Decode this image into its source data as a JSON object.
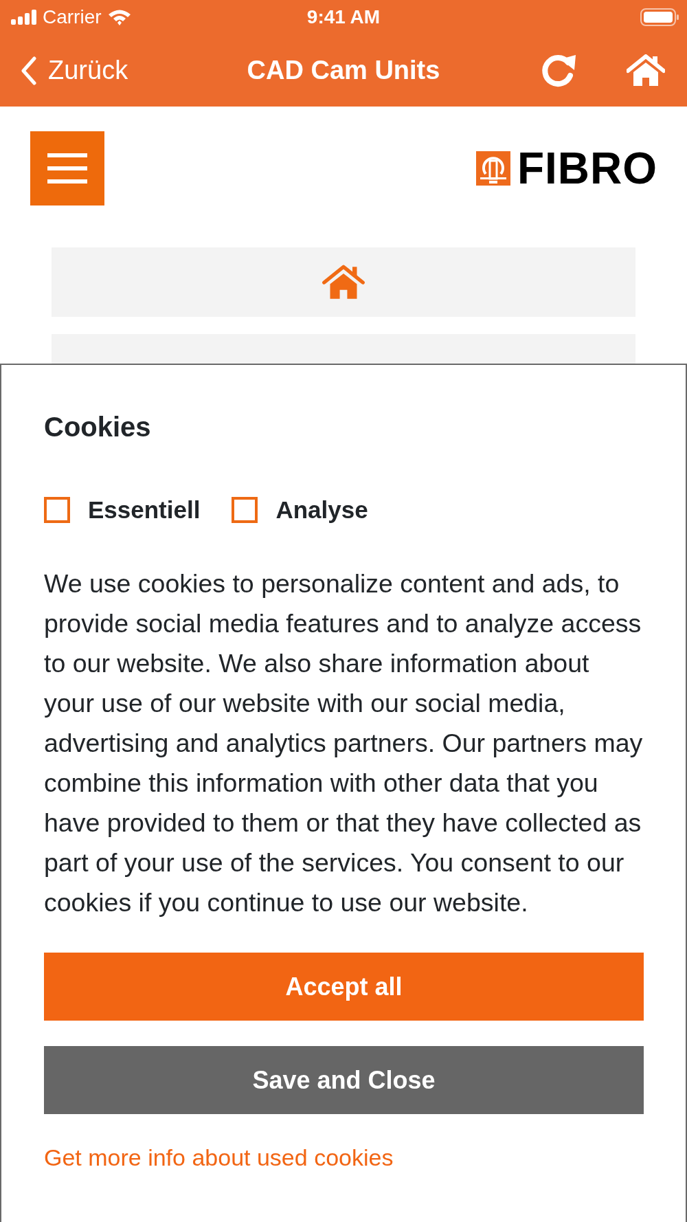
{
  "status_bar": {
    "carrier": "Carrier",
    "time": "9:41 AM"
  },
  "nav_bar": {
    "back": "Zurück",
    "title": "CAD Cam Units"
  },
  "header": {
    "logo": "FIBRO"
  },
  "menu_items": [
    {
      "kind": "icon"
    },
    {
      "kind": "blank"
    }
  ],
  "cookie_dialog": {
    "title": "Cookies",
    "options": [
      {
        "label": "Essentiell",
        "checked": false
      },
      {
        "label": "Analyse",
        "checked": false
      }
    ],
    "text": "We use cookies to personalize content and ads, to provide social media features and to analyze access to our website. We also share information about your use of our website with our social media, advertising and analytics partners. Our partners may combine this information with other data that you have provided to them or that they have collected as part of your use of the services. You consent to our cookies if you continue to use our website.",
    "buttons": [
      {
        "label": "Accept all",
        "kind": "primary"
      },
      {
        "label": "Save and Close",
        "kind": "secondary"
      }
    ],
    "link": "Get more info about used cookies"
  }
}
